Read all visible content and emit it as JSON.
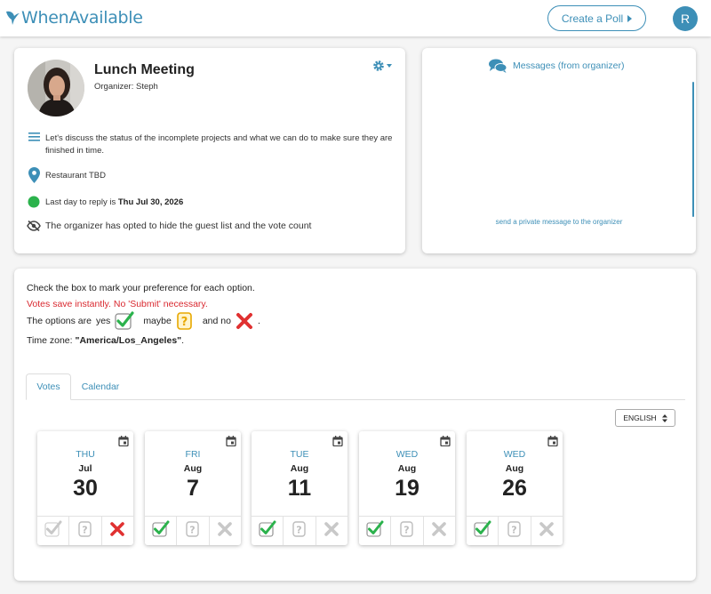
{
  "header": {
    "logo_text": "WhenAvailable",
    "create_button": "Create a Poll",
    "avatar_letter": "R",
    "brand_color": "#3d8fb7"
  },
  "event": {
    "title": "Lunch Meeting",
    "organizer": "Organizer: Steph",
    "description": "Let's discuss the status of the incomplete projects and what we can do to make sure they are finished in time.",
    "location": "Restaurant TBD",
    "deadline_prefix": "Last day to reply is",
    "deadline_date": "Thu Jul 30, 2026",
    "guest_note": "The organizer has opted to hide the guest list and the vote count"
  },
  "messages": {
    "title": "Messages (from organizer)",
    "link": "send a private message to the organizer"
  },
  "voting": {
    "instruction": "Check the box to mark your preference for each option.",
    "save_note": "Votes save instantly. No 'Submit' necessary.",
    "options_prefix": "The options are",
    "yes": "yes",
    "maybe": "maybe",
    "and_no": "and no",
    "period": ".",
    "timezone_prefix": "Time zone:",
    "timezone": "\"America/Los_Angeles\"",
    "tabs": [
      "Votes",
      "Calendar"
    ],
    "language": "ENGLISH",
    "days": [
      {
        "dow": "THU",
        "month": "Jul",
        "day": "30",
        "vote": "no"
      },
      {
        "dow": "FRI",
        "month": "Aug",
        "day": "7",
        "vote": "yes"
      },
      {
        "dow": "TUE",
        "month": "Aug",
        "day": "11",
        "vote": "yes"
      },
      {
        "dow": "WED",
        "month": "Aug",
        "day": "19",
        "vote": "yes"
      },
      {
        "dow": "WED",
        "month": "Aug",
        "day": "26",
        "vote": "yes"
      }
    ]
  }
}
